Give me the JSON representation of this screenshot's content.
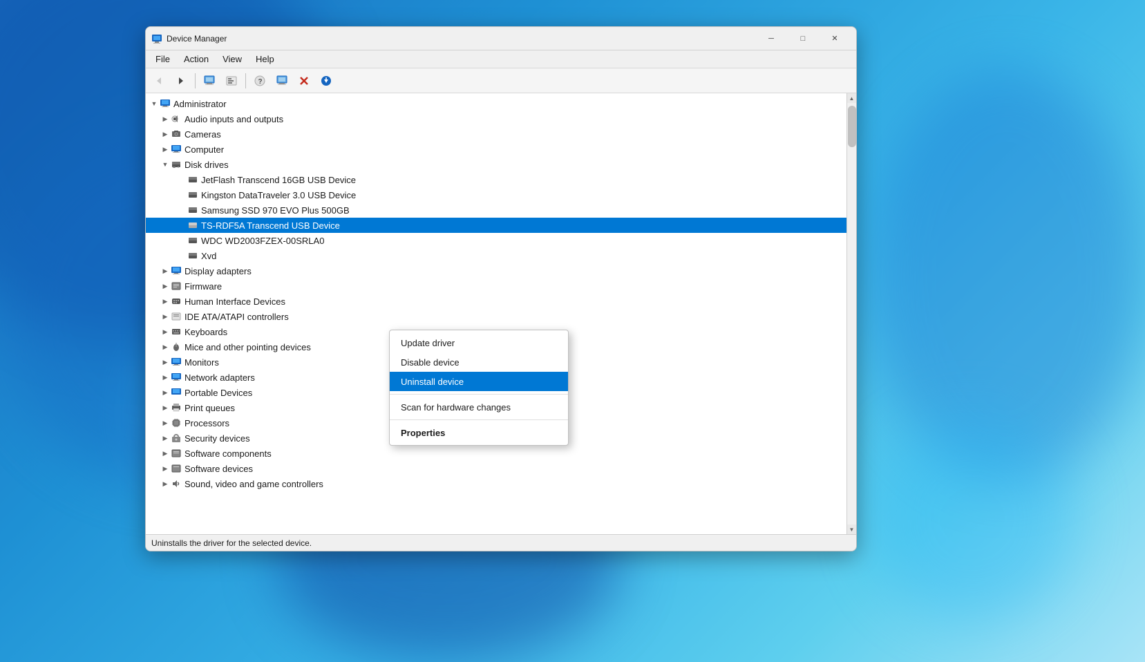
{
  "window": {
    "title": "Device Manager",
    "icon": "🖥"
  },
  "titlebar": {
    "minimize": "─",
    "maximize": "□",
    "close": "✕"
  },
  "menubar": {
    "items": [
      "File",
      "Action",
      "View",
      "Help"
    ]
  },
  "toolbar": {
    "buttons": [
      {
        "name": "back",
        "icon": "◀",
        "disabled": true
      },
      {
        "name": "forward",
        "icon": "▶",
        "disabled": false
      },
      {
        "name": "view-resources-by-type",
        "icon": "🖥",
        "disabled": false
      },
      {
        "name": "view-resources-by-connection",
        "icon": "📄",
        "disabled": false
      },
      {
        "name": "help",
        "icon": "?",
        "disabled": false
      },
      {
        "name": "view-devices-by-type",
        "icon": "🗂",
        "disabled": false
      },
      {
        "name": "scan-hardware",
        "icon": "🖥",
        "disabled": false
      },
      {
        "name": "update-driver",
        "icon": "🔴",
        "disabled": false
      },
      {
        "name": "download",
        "icon": "⬇",
        "disabled": false
      }
    ]
  },
  "tree": {
    "items": [
      {
        "id": "administrator",
        "label": "Administrator",
        "indent": 0,
        "expander": "▼",
        "icon": "💻",
        "expanded": true,
        "selected": false
      },
      {
        "id": "audio",
        "label": "Audio inputs and outputs",
        "indent": 1,
        "expander": "▶",
        "icon": "🔊",
        "expanded": false,
        "selected": false
      },
      {
        "id": "cameras",
        "label": "Cameras",
        "indent": 1,
        "expander": "▶",
        "icon": "📷",
        "expanded": false,
        "selected": false
      },
      {
        "id": "computer",
        "label": "Computer",
        "indent": 1,
        "expander": "▶",
        "icon": "🖥",
        "expanded": false,
        "selected": false
      },
      {
        "id": "disk-drives",
        "label": "Disk drives",
        "indent": 1,
        "expander": "▼",
        "icon": "💾",
        "expanded": true,
        "selected": false
      },
      {
        "id": "jetflash",
        "label": "JetFlash Transcend 16GB USB Device",
        "indent": 2,
        "expander": "",
        "icon": "💾",
        "expanded": false,
        "selected": false
      },
      {
        "id": "kingston",
        "label": "Kingston DataTraveler 3.0 USB Device",
        "indent": 2,
        "expander": "",
        "icon": "💾",
        "expanded": false,
        "selected": false
      },
      {
        "id": "samsung",
        "label": "Samsung SSD 970 EVO Plus 500GB",
        "indent": 2,
        "expander": "",
        "icon": "💾",
        "expanded": false,
        "selected": false
      },
      {
        "id": "ts-rdf5a",
        "label": "TS-RDF5A Transcend USB Device",
        "indent": 2,
        "expander": "",
        "icon": "💾",
        "expanded": false,
        "selected": true
      },
      {
        "id": "wdc",
        "label": "WDC WD2003FZEX-00SRLA0",
        "indent": 2,
        "expander": "",
        "icon": "💾",
        "expanded": false,
        "selected": false
      },
      {
        "id": "xvd",
        "label": "Xvd",
        "indent": 2,
        "expander": "",
        "icon": "💾",
        "expanded": false,
        "selected": false
      },
      {
        "id": "display-adapters",
        "label": "Display adapters",
        "indent": 1,
        "expander": "▶",
        "icon": "🖥",
        "expanded": false,
        "selected": false
      },
      {
        "id": "firmware",
        "label": "Firmware",
        "indent": 1,
        "expander": "▶",
        "icon": "⚙",
        "expanded": false,
        "selected": false
      },
      {
        "id": "hid",
        "label": "Human Interface Devices",
        "indent": 1,
        "expander": "▶",
        "icon": "⌨",
        "expanded": false,
        "selected": false
      },
      {
        "id": "ide",
        "label": "IDE ATA/ATAPI controllers",
        "indent": 1,
        "expander": "▶",
        "icon": "📋",
        "expanded": false,
        "selected": false
      },
      {
        "id": "keyboards",
        "label": "Keyboards",
        "indent": 1,
        "expander": "▶",
        "icon": "⌨",
        "expanded": false,
        "selected": false
      },
      {
        "id": "mice",
        "label": "Mice and other pointing devices",
        "indent": 1,
        "expander": "▶",
        "icon": "🖱",
        "expanded": false,
        "selected": false
      },
      {
        "id": "monitors",
        "label": "Monitors",
        "indent": 1,
        "expander": "▶",
        "icon": "🖥",
        "expanded": false,
        "selected": false
      },
      {
        "id": "network",
        "label": "Network adapters",
        "indent": 1,
        "expander": "▶",
        "icon": "🌐",
        "expanded": false,
        "selected": false
      },
      {
        "id": "portable",
        "label": "Portable Devices",
        "indent": 1,
        "expander": "▶",
        "icon": "📱",
        "expanded": false,
        "selected": false
      },
      {
        "id": "print",
        "label": "Print queues",
        "indent": 1,
        "expander": "▶",
        "icon": "🖨",
        "expanded": false,
        "selected": false
      },
      {
        "id": "processors",
        "label": "Processors",
        "indent": 1,
        "expander": "▶",
        "icon": "⚙",
        "expanded": false,
        "selected": false
      },
      {
        "id": "security",
        "label": "Security devices",
        "indent": 1,
        "expander": "▶",
        "icon": "🔒",
        "expanded": false,
        "selected": false
      },
      {
        "id": "software-components",
        "label": "Software components",
        "indent": 1,
        "expander": "▶",
        "icon": "📦",
        "expanded": false,
        "selected": false
      },
      {
        "id": "software-devices",
        "label": "Software devices",
        "indent": 1,
        "expander": "▶",
        "icon": "📦",
        "expanded": false,
        "selected": false
      },
      {
        "id": "sound",
        "label": "Sound, video and game controllers",
        "indent": 1,
        "expander": "▶",
        "icon": "🎵",
        "expanded": false,
        "selected": false
      }
    ]
  },
  "context_menu": {
    "items": [
      {
        "id": "update-driver",
        "label": "Update driver",
        "selected": false,
        "bold": false,
        "separator_after": false
      },
      {
        "id": "disable-device",
        "label": "Disable device",
        "selected": false,
        "bold": false,
        "separator_after": false
      },
      {
        "id": "uninstall-device",
        "label": "Uninstall device",
        "selected": true,
        "bold": false,
        "separator_after": true
      },
      {
        "id": "scan-hardware",
        "label": "Scan for hardware changes",
        "selected": false,
        "bold": false,
        "separator_after": true
      },
      {
        "id": "properties",
        "label": "Properties",
        "selected": false,
        "bold": true,
        "separator_after": false
      }
    ]
  },
  "status_bar": {
    "text": "Uninstalls the driver for the selected device."
  }
}
